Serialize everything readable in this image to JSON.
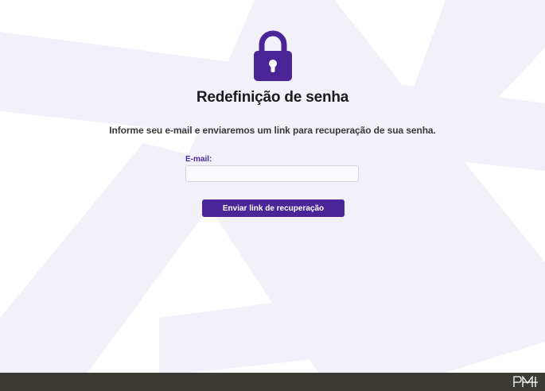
{
  "page": {
    "title": "Redefinição de senha",
    "instructions": "Informe seu e-mail e enviaremos um link para recuperação de sua senha."
  },
  "form": {
    "email_label": "E-mail:",
    "email_value": "",
    "email_placeholder": "",
    "submit_label": "Enviar link de recuperação"
  },
  "icons": {
    "lock": "lock-icon",
    "footer_logo": "brand-logo-icon"
  },
  "colors": {
    "accent": "#4b2497",
    "background_art": "#f1eff8",
    "footer": "#3b3a35",
    "title": "#1c1c1c"
  }
}
